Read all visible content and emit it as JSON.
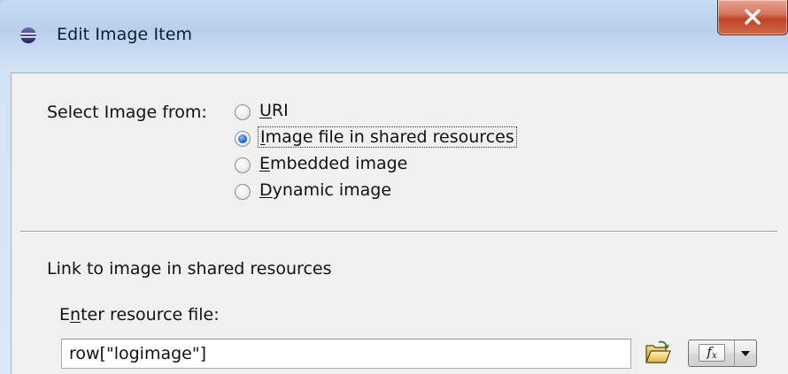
{
  "window": {
    "title": "Edit Image Item",
    "close_label": "X"
  },
  "source": {
    "label": "Select Image from:",
    "options": [
      {
        "mnemonic": "U",
        "rest": "RI",
        "selected": false
      },
      {
        "mnemonic": "I",
        "rest": "mage file in shared resources",
        "selected": true
      },
      {
        "mnemonic": "E",
        "rest": "mbedded image",
        "selected": false
      },
      {
        "mnemonic": "D",
        "rest": "ynamic image",
        "selected": false
      }
    ]
  },
  "section": {
    "title": "Link to image in shared resources"
  },
  "resource": {
    "label_pre": "E",
    "label_mnemonic": "n",
    "label_post": "ter resource file:",
    "value": "row[\"logimage\"]"
  },
  "expression_button": {
    "icon": "fx-icon",
    "main": "f",
    "sub": "x"
  },
  "colors": {
    "selected_radio": "#2a72c9",
    "close_button": "#c1432a"
  }
}
